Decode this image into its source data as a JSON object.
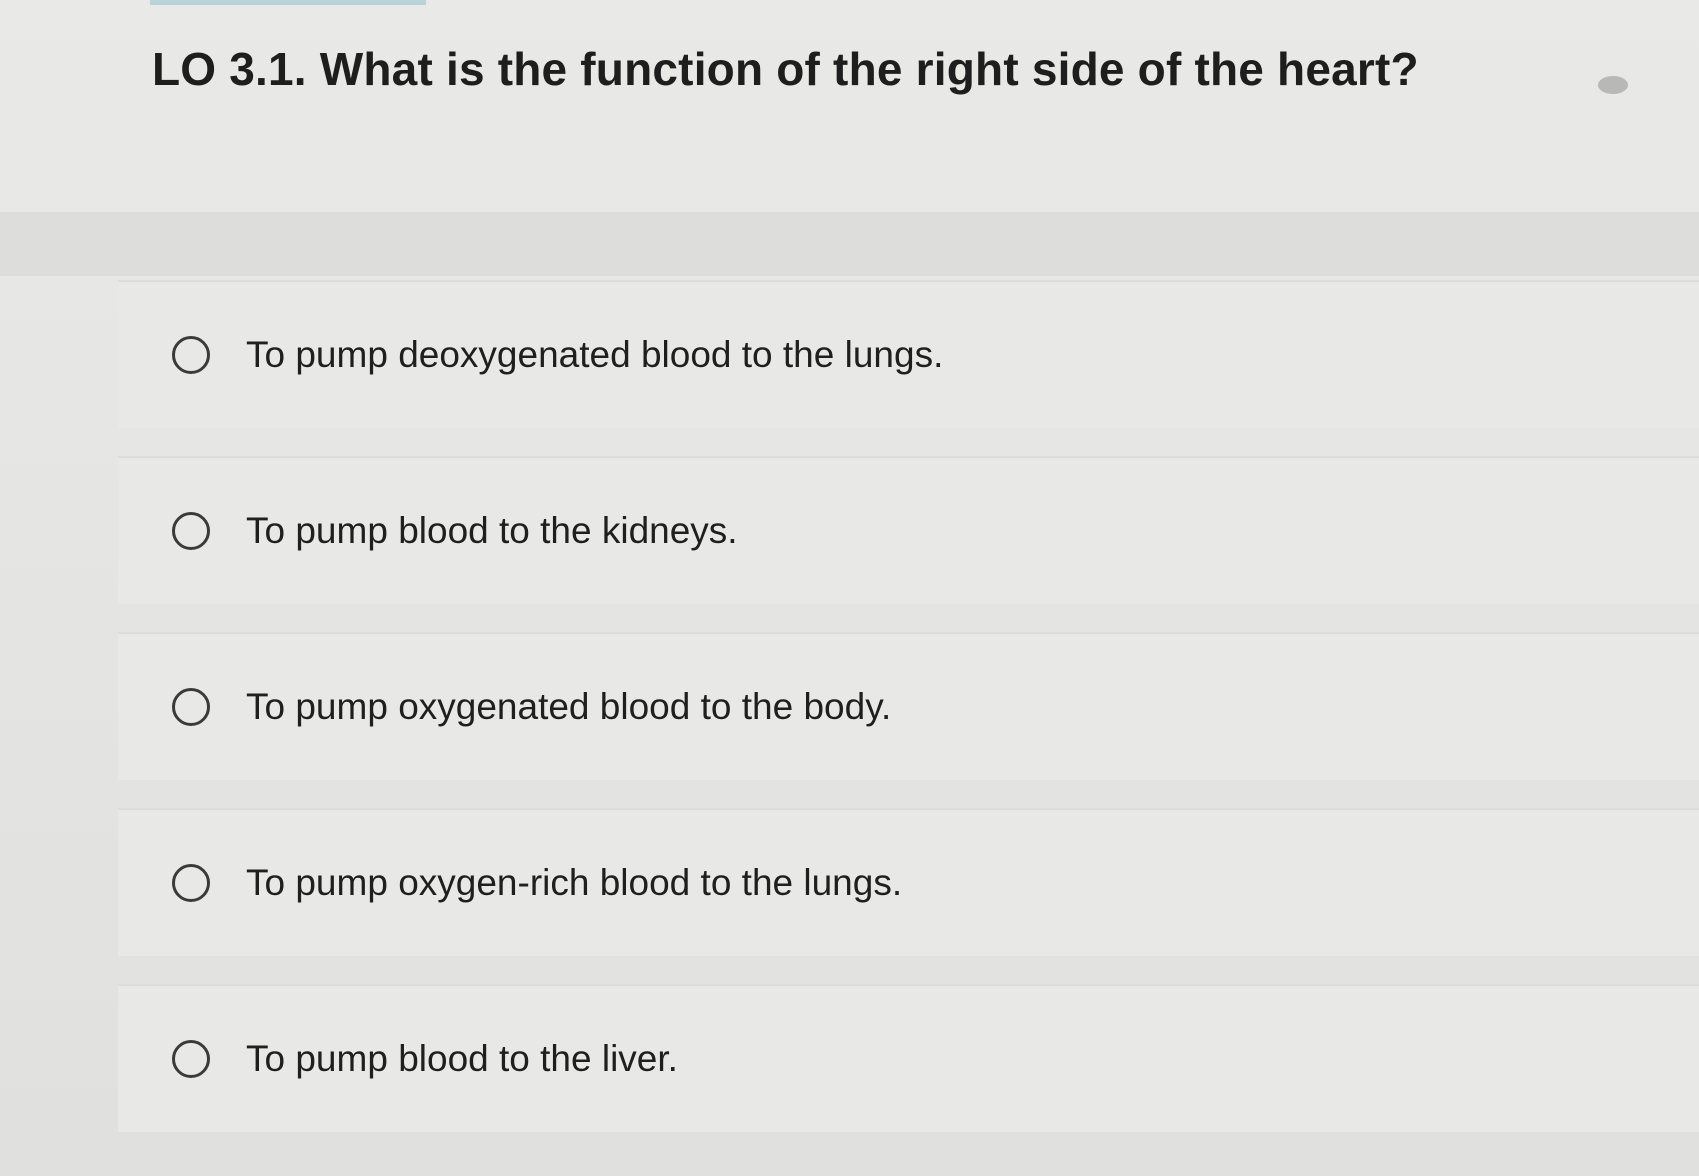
{
  "question": {
    "text": "LO 3.1. What is the function of the right side of the heart?"
  },
  "options": [
    {
      "label": "To pump deoxygenated blood to the lungs."
    },
    {
      "label": "To pump blood to the kidneys."
    },
    {
      "label": "To pump oxygenated blood to the body."
    },
    {
      "label": "To pump oxygen-rich blood to the lungs."
    },
    {
      "label": "To pump blood to the liver."
    }
  ]
}
